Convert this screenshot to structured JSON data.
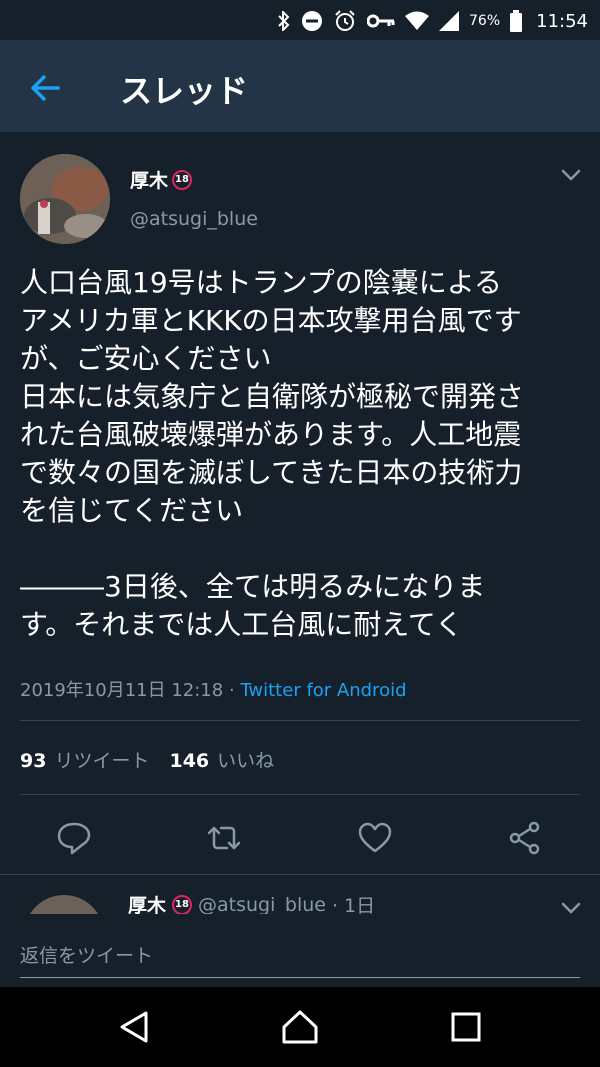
{
  "status_bar": {
    "battery": "76%",
    "time": "11:54",
    "icons": [
      "bluetooth-icon",
      "do-not-disturb-icon",
      "alarm-icon",
      "key-icon",
      "wifi-icon",
      "signal-icon",
      "battery-icon"
    ]
  },
  "app_bar": {
    "title": "スレッド",
    "back_icon": "arrow-left-icon"
  },
  "tweet": {
    "name": "厚木",
    "age_badge": "18",
    "handle": "@atsugi_blue",
    "text": "人口台風19号はトランプの陰嚢による\nアメリカ軍とKKKの日本攻撃用台風です\nが、ご安心ください\n日本には気象庁と自衛隊が極秘で開発さ\nれた台風破壊爆弾があります。人工地震\nで数々の国を滅ぼしてきた日本の技術力\nを信じてください\n\n―――3日後、全ては明るみになりま\nす。それまでは人工台風に耐えてく",
    "timestamp": "2019年10月11日 12:18",
    "separator": " · ",
    "source": "Twitter for Android",
    "retweet_count": "93",
    "retweet_label": "リツイート",
    "like_count": "146",
    "like_label": "いいね"
  },
  "reply_preview": {
    "name": "厚木",
    "age_badge": "18",
    "handle": "@atsugi_blue",
    "time": "· 1日"
  },
  "compose": {
    "placeholder": "返信をツイート"
  },
  "colors": {
    "background": "#15202b",
    "app_bar": "#243447",
    "accent": "#1da1f2",
    "secondary_text": "#8899a6"
  }
}
